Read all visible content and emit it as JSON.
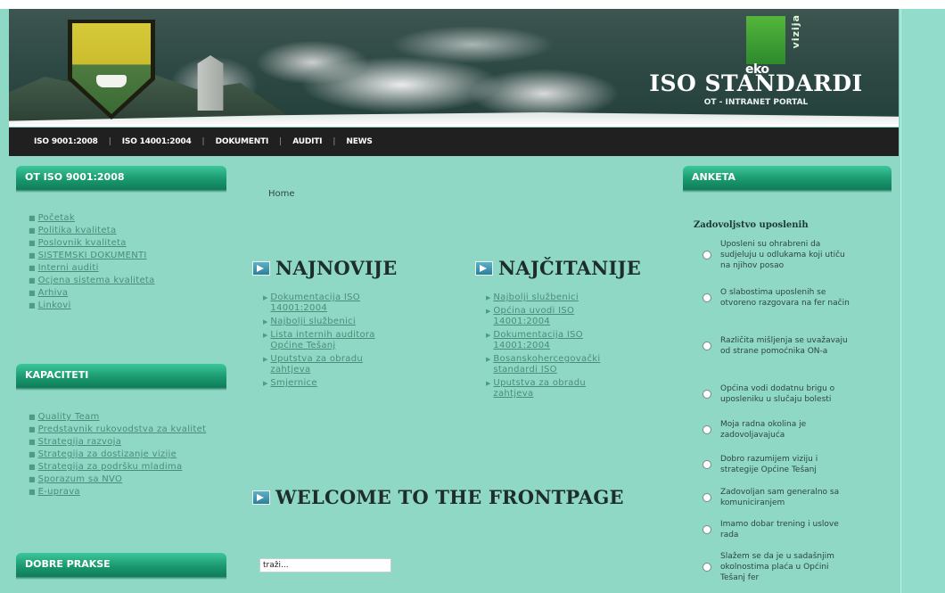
{
  "header": {
    "logo_text": "eko",
    "logo_sub": "vizija",
    "site_title": "ISO STANDARDI",
    "site_subtitle": "OT - INTRANET PORTAL"
  },
  "nav": {
    "items": [
      "ISO 9001:2008",
      "ISO 14001:2004",
      "DOKUMENTI",
      "AUDITI",
      "NEWS"
    ]
  },
  "left": {
    "box1_title": "OT ISO 9001:2008",
    "box1_items": [
      "Početak",
      "Politika kvaliteta",
      "Poslovnik kvaliteta",
      "SISTEMSKI DOKUMENTI",
      "Interni auditi",
      "Ocjena sistema kvaliteta",
      "Arhiva",
      "Linkovi"
    ],
    "box2_title": "KAPACITETI",
    "box2_items": [
      "Quality Team",
      "Predstavnik rukovodstva za kvalitet",
      "Strategija razvoja",
      "Strategija za dostizanje vizije",
      "Strategija za podršku mladima",
      "Sporazum sa NVO",
      "E-uprava"
    ],
    "box3_title": "DOBRE PRAKSE"
  },
  "center": {
    "breadcrumb": "Home",
    "newest_title": "NAJNOVIJE",
    "newest_items": [
      "Dokumentacija ISO 14001:2004",
      "Najbolji službenici",
      "Lista internih auditora Općine Tešanj",
      "Uputstva za obradu zahtjeva",
      "Smjernice"
    ],
    "mostread_title": "NAJČITANIJE",
    "mostread_items": [
      "Najbolji službenici",
      "Općina uvodi ISO 14001:2004",
      "Dokumentacija ISO 14001:2004",
      "Bosanskohercegovački standardi ISO",
      "Uputstva za obradu zahtjeva"
    ],
    "welcome_title": "WELCOME TO THE FRONTPAGE",
    "search_placeholder": "traži..."
  },
  "poll": {
    "title": "ANKETA",
    "question": "Zadovoljstvo uposlenih",
    "options": [
      "Uposleni su ohrabreni da sudjeluju u odlukama koji utiču na njihov posao",
      "O slabostima uposlenih se otvoreno razgovara na fer način",
      "Različita mišljenja se uvažavaju od strane pomoćnika ON-a",
      "Općina vodi dodatnu brigu o uposleniku u slučaju bolesti",
      "Moja radna okolina je zadovoljavajuća",
      "Dobro razumijem viziju i strategije Općine Tešanj",
      "Zadovoljan sam generalno sa komuniciranjem",
      "Imamo dobar trening i uslove rada",
      "Slažem se da je u sadašnjim okolnostima plaća u Općini Tešanj fer"
    ]
  }
}
